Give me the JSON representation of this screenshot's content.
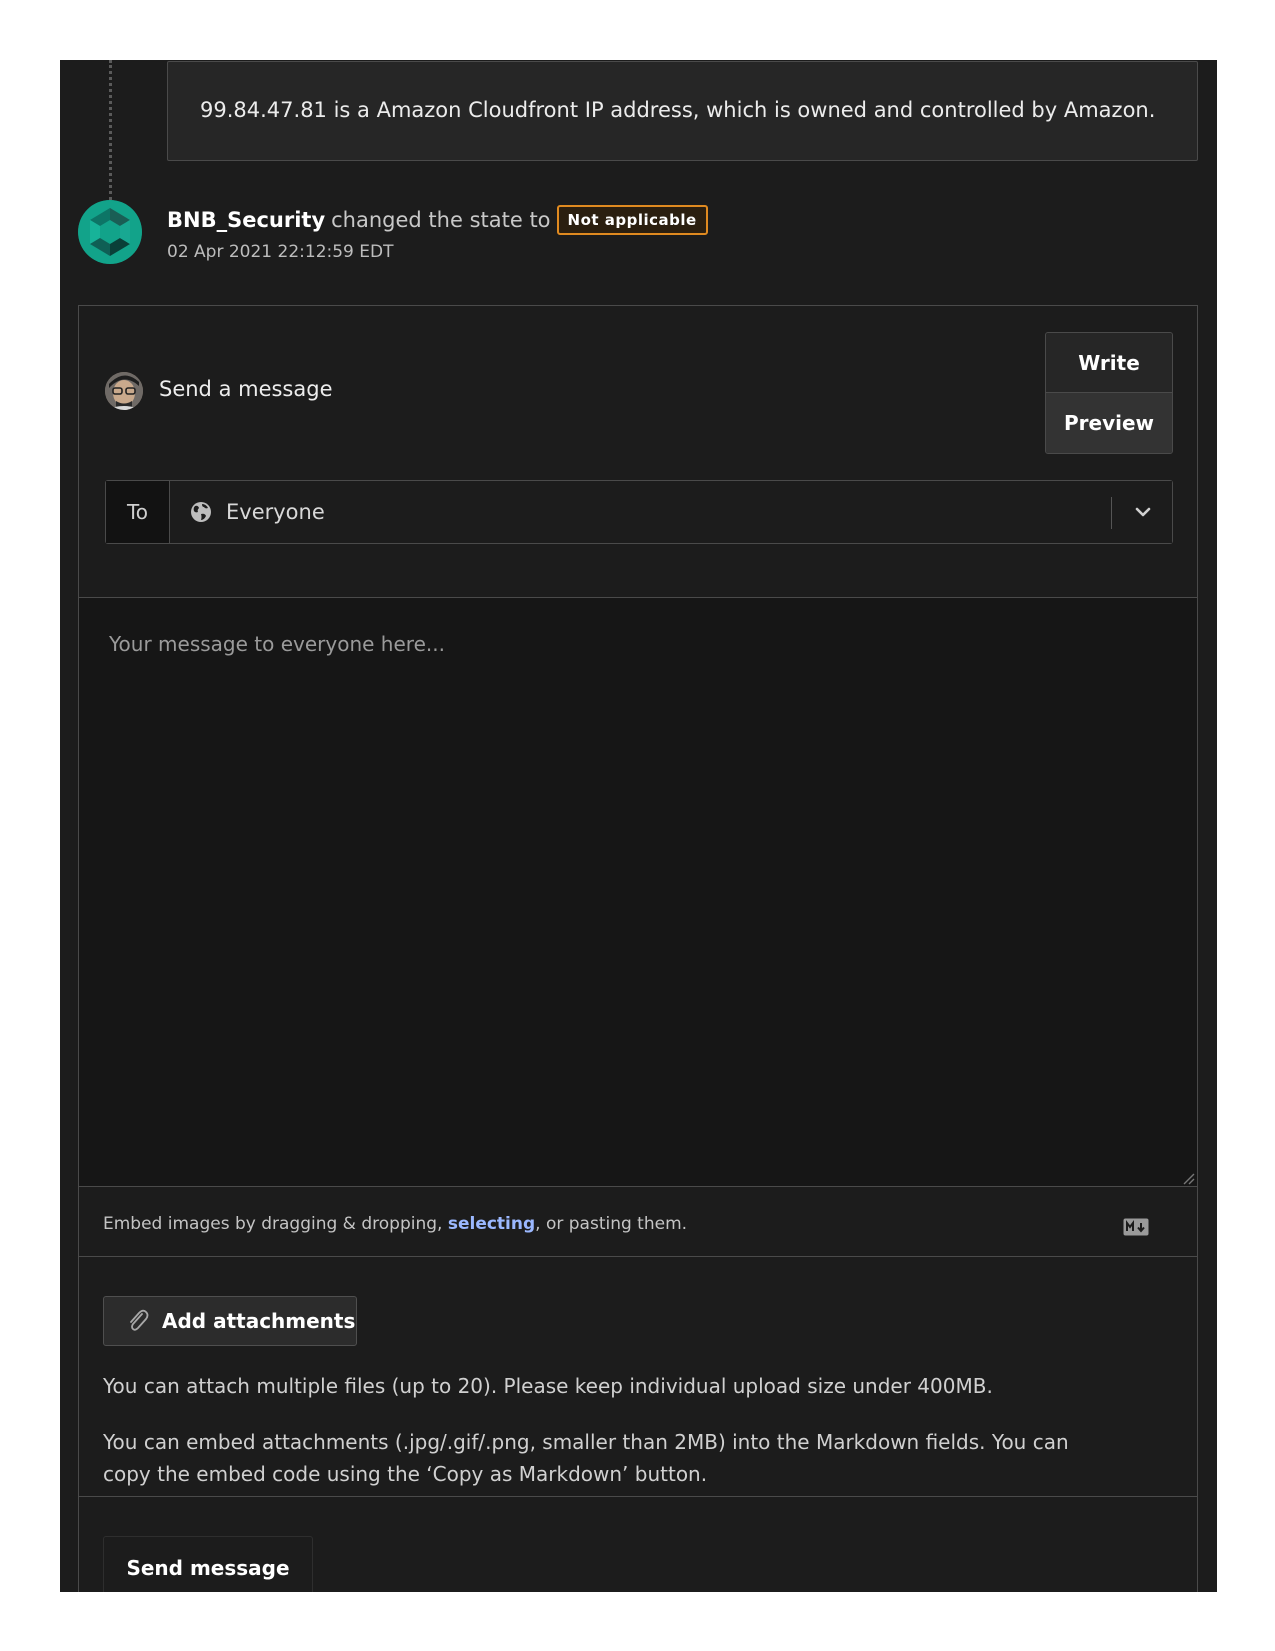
{
  "event": {
    "previous_comment": "99.84.47.81 is a Amazon Cloudfront IP address, which is owned and controlled by Amazon.",
    "actor": "BNB_Security",
    "action_text": "changed the state to",
    "state_badge": "Not applicable",
    "timestamp": "02 Apr 2021 22:12:59 EDT",
    "avatar_icon": "hexagon-logo-icon",
    "badge_color": "#e08a20"
  },
  "composer": {
    "title": "Send a message",
    "tabs": [
      {
        "label": "Write",
        "active": true
      },
      {
        "label": "Preview",
        "active": false
      }
    ],
    "to_label": "To",
    "recipient": "Everyone",
    "recipient_icon": "globe-icon",
    "message_placeholder": "Your message to everyone here...",
    "embed_note": {
      "before": "Embed images by dragging & dropping, ",
      "link": "selecting",
      "after": ", or pasting them."
    },
    "markdown_icon": "markdown-icon",
    "attach_button": "Add attachments",
    "attach_help": "You can attach multiple files (up to 20). Please keep individual upload size under 400MB.",
    "embed_help": "You can embed attachments (.jpg/.gif/.png, smaller than 2MB) into the Markdown fields. You can copy the embed code using the ‘Copy as Markdown’ button.",
    "send_button": "Send message",
    "link_color": "#9bb8ff"
  }
}
